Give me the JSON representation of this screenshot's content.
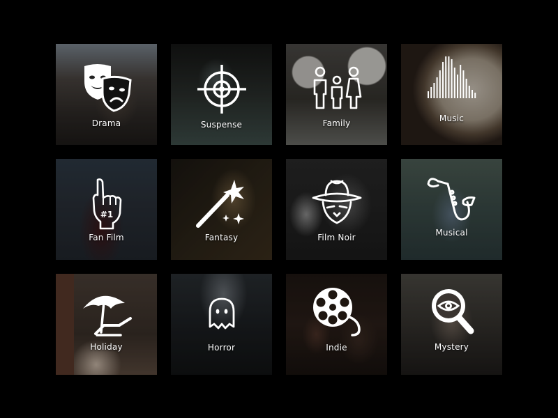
{
  "genres": [
    {
      "id": "drama",
      "label": "Drama",
      "icon": "theater-masks-icon"
    },
    {
      "id": "suspense",
      "label": "Suspense",
      "icon": "crosshair-icon"
    },
    {
      "id": "family",
      "label": "Family",
      "icon": "family-icon"
    },
    {
      "id": "music",
      "label": "Music",
      "icon": "sound-wave-icon"
    },
    {
      "id": "fanfilm",
      "label": "Fan Film",
      "icon": "foam-finger-icon"
    },
    {
      "id": "fantasy",
      "label": "Fantasy",
      "icon": "magic-wand-icon"
    },
    {
      "id": "filmnoir",
      "label": "Film Noir",
      "icon": "detective-hat-icon"
    },
    {
      "id": "musical",
      "label": "Musical",
      "icon": "saxophone-icon"
    },
    {
      "id": "holiday",
      "label": "Holiday",
      "icon": "beach-umbrella-icon"
    },
    {
      "id": "horror",
      "label": "Horror",
      "icon": "ghost-icon"
    },
    {
      "id": "indie",
      "label": "Indie",
      "icon": "film-reel-icon"
    },
    {
      "id": "mystery",
      "label": "Mystery",
      "icon": "magnifying-glass-eye-icon"
    }
  ],
  "foam_finger_text": "#1",
  "colors": {
    "background": "#000000",
    "label": "#ffffff",
    "icon": "#ffffff"
  }
}
